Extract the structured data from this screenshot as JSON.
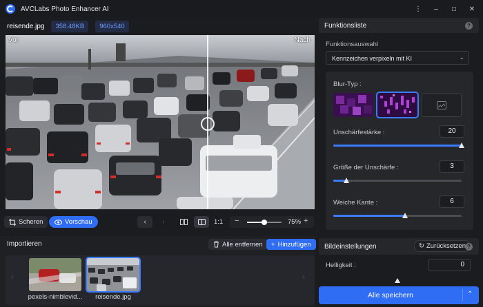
{
  "app": {
    "title": "AVCLabs Photo Enhancer AI"
  },
  "window_controls": {
    "menu": "⋮",
    "minimize": "–",
    "maximize": "□",
    "close": "✕"
  },
  "file": {
    "name": "reisende.jpg",
    "size": "358.48KB",
    "resolution": "960x540"
  },
  "preview": {
    "before_label": "Vor",
    "after_label": "Nach"
  },
  "toolbar": {
    "crop_label": "Scheren",
    "preview_label": "Vorschau",
    "ratio_label": "1:1",
    "zoom_percent": "75%",
    "zoom_level": 0.5
  },
  "import": {
    "title": "Importieren",
    "remove_all_label": "Alle entfernen",
    "add_label": "Hinzufügen",
    "files": [
      {
        "caption": "pexels-nimblevid..."
      },
      {
        "caption": "reisende.jpg"
      }
    ]
  },
  "functions": {
    "title": "Funktionsliste",
    "selection_label": "Funktionsauswahl",
    "selected_function": "Kennzeichen verpixeln mit KI",
    "blur_type_label": "Blur-Typ :",
    "blur_types": [
      "pixel-large-icon",
      "pixel-small-icon",
      "image-icon"
    ],
    "selected_blur_type": 1,
    "sliders": [
      {
        "label": "Unschärfestärke :",
        "value": "20",
        "level": 1.0
      },
      {
        "label": "Größe der Unschärfe :",
        "value": "3",
        "level": 0.1
      },
      {
        "label": "Weiche Kante :",
        "value": "6",
        "level": 0.56
      }
    ]
  },
  "image_settings": {
    "title": "Bildeinstellungen",
    "reset_label": "Zurücksetzen",
    "brightness_label": "Helligkeit :",
    "brightness_value": "0"
  },
  "save": {
    "label": "Alle speichern"
  },
  "colors": {
    "accent": "#2f6df5",
    "panel": "#26272b",
    "background": "#1b1c20"
  }
}
